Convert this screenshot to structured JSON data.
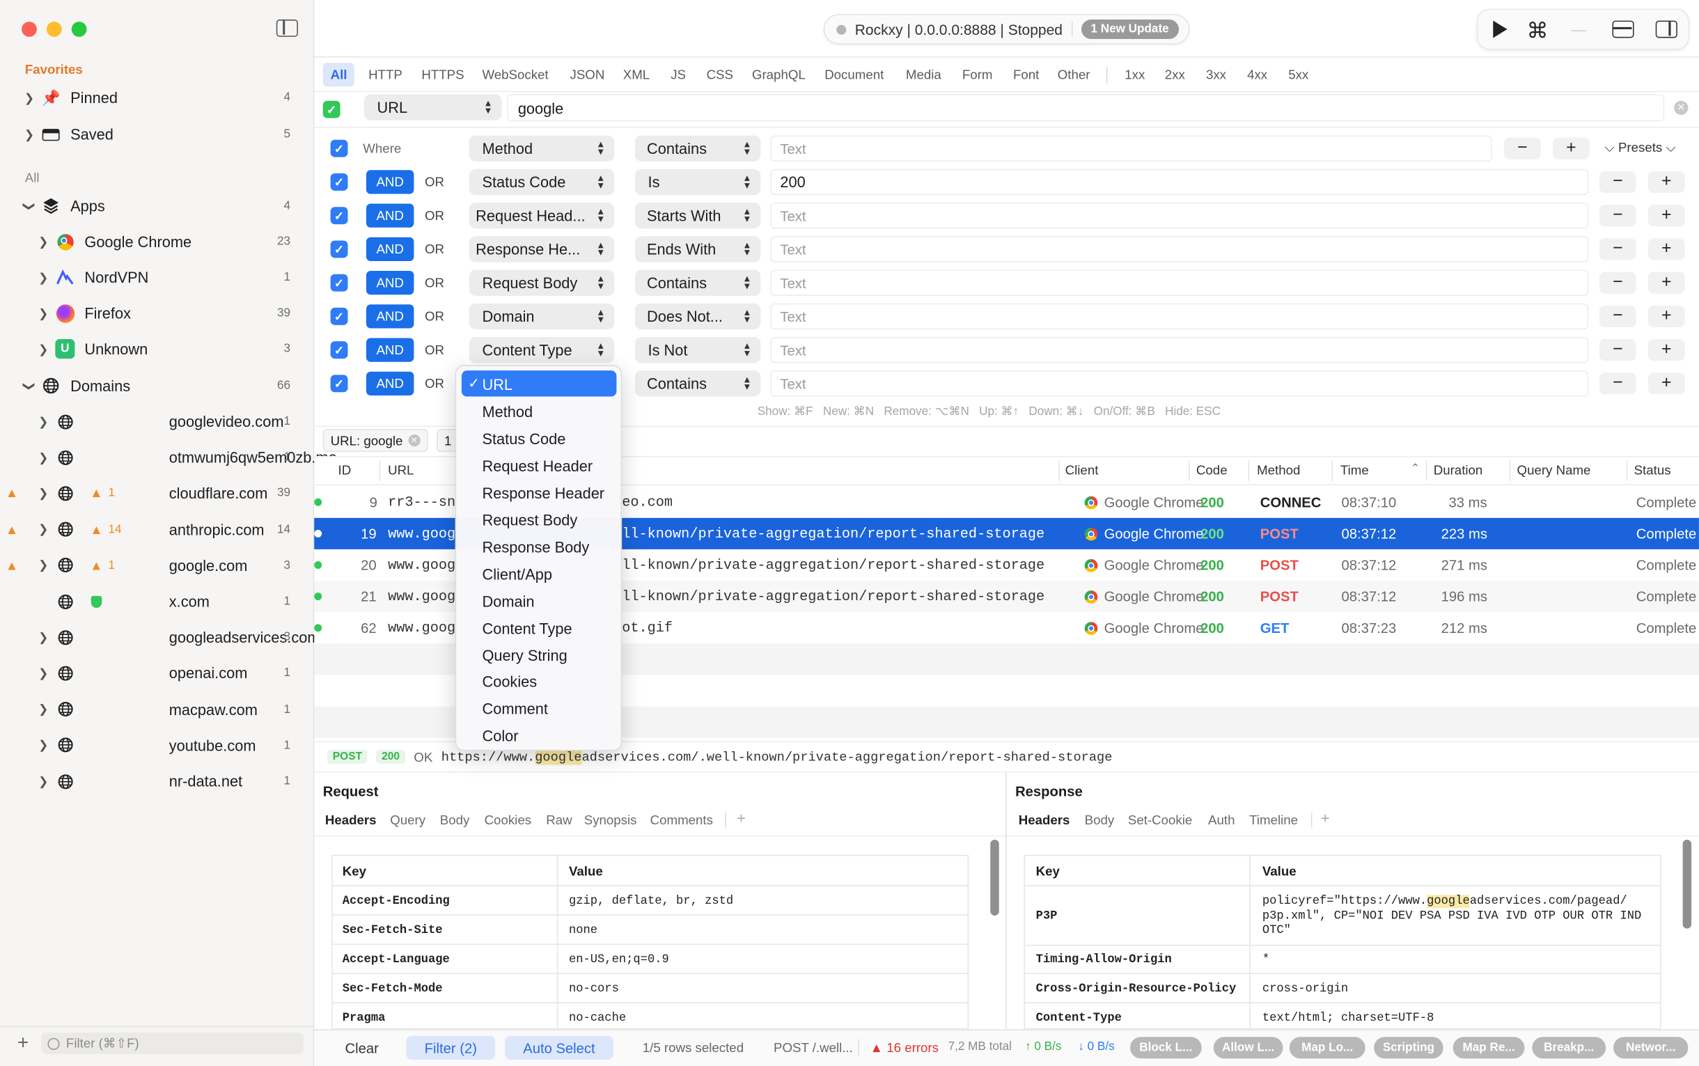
{
  "window": {
    "title": "Rockxy | 0.0.0.0:8888 | Stopped",
    "update_badge": "1 New Update"
  },
  "sidebar": {
    "favorites_label": "Favorites",
    "favorites": [
      {
        "label": "Pinned",
        "count": "4"
      },
      {
        "label": "Saved",
        "count": "5"
      }
    ],
    "all_label": "All",
    "apps": {
      "label": "Apps",
      "count": "4",
      "items": [
        {
          "label": "Google Chrome",
          "count": "23",
          "icon": "chrome-icon"
        },
        {
          "label": "NordVPN",
          "count": "1",
          "icon": "nordvpn-icon"
        },
        {
          "label": "Firefox",
          "count": "39",
          "icon": "firefox-icon"
        },
        {
          "label": "Unknown",
          "count": "3",
          "icon": "unknown-app-icon",
          "icon_letter": "U"
        }
      ]
    },
    "domains": {
      "label": "Domains",
      "count": "66",
      "items": [
        {
          "label": "googlevideo.com",
          "count": "1"
        },
        {
          "label": "otmwumj6qw5em0zb.me",
          "count": "1"
        },
        {
          "label": "cloudflare.com",
          "count": "39",
          "warn": "1"
        },
        {
          "label": "anthropic.com",
          "count": "14",
          "warn": "14"
        },
        {
          "label": "google.com",
          "count": "3",
          "warn": "1"
        },
        {
          "label": "x.com",
          "count": "1",
          "shield": true
        },
        {
          "label": "googleadservices.com",
          "count": "3"
        },
        {
          "label": "openai.com",
          "count": "1"
        },
        {
          "label": "macpaw.com",
          "count": "1"
        },
        {
          "label": "youtube.com",
          "count": "1"
        },
        {
          "label": "nr-data.net",
          "count": "1"
        }
      ]
    },
    "filter_placeholder": "Filter (⌘⇧F)"
  },
  "filter_tabs": [
    "All",
    "HTTP",
    "HTTPS",
    "WebSocket",
    "JSON",
    "XML",
    "JS",
    "CSS",
    "GraphQL",
    "Document",
    "Media",
    "Form",
    "Font",
    "Other",
    "1xx",
    "2xx",
    "3xx",
    "4xx",
    "5xx"
  ],
  "search": {
    "field": "URL",
    "value": "google"
  },
  "rules": {
    "where_label": "Where",
    "and_label": "AND",
    "or_label": "OR",
    "presets_label": "Presets",
    "rows": [
      {
        "field": "Method",
        "op": "Contains",
        "value": "",
        "placeholder": "Text"
      },
      {
        "field": "Status Code",
        "op": "Is",
        "value": "200",
        "placeholder": "Text"
      },
      {
        "field": "Request Head...",
        "op": "Starts With",
        "value": "",
        "placeholder": "Text"
      },
      {
        "field": "Response He...",
        "op": "Ends With",
        "value": "",
        "placeholder": "Text"
      },
      {
        "field": "Request Body",
        "op": "Contains",
        "value": "",
        "placeholder": "Text"
      },
      {
        "field": "Domain",
        "op": "Does Not...",
        "value": "",
        "placeholder": "Text"
      },
      {
        "field": "Content Type",
        "op": "Is Not",
        "value": "",
        "placeholder": "Text"
      },
      {
        "field": "URL",
        "op": "Contains",
        "value": "",
        "placeholder": "Text"
      }
    ],
    "shortcuts": "Show: ⌘F   New: ⌘N   Remove: ⌥⌘N   Up: ⌘↑   Down: ⌘↓   On/Off: ⌘B   Hide: ESC"
  },
  "dropdown": {
    "selected": "URL",
    "items": [
      "URL",
      "Method",
      "Status Code",
      "Request Header",
      "Response Header",
      "Request Body",
      "Response Body",
      "Client/App",
      "Domain",
      "Content Type",
      "Query String",
      "Cookies",
      "Comment",
      "Color"
    ]
  },
  "active_filter": {
    "chip": "URL: google",
    "extra": "1"
  },
  "table": {
    "columns": [
      "ID",
      "URL",
      "Client",
      "Code",
      "Method",
      "Time",
      "Duration",
      "Query Name",
      "Status"
    ],
    "rows": [
      {
        "id": "9",
        "url_a": "rr3---sn",
        "url_b": "eo.com",
        "client": "Google Chrome",
        "code": "200",
        "method": "CONNEC",
        "time": "08:37:10",
        "duration": "33 ms",
        "status": "Complete"
      },
      {
        "id": "19",
        "url_a": "www.goog",
        "url_b": "ll-known/private-aggregation/report-shared-storage",
        "client": "Google Chrome",
        "code": "200",
        "method": "POST",
        "time": "08:37:12",
        "duration": "223 ms",
        "status": "Complete",
        "selected": true
      },
      {
        "id": "20",
        "url_a": "www.goog",
        "url_b": "ll-known/private-aggregation/report-shared-storage",
        "client": "Google Chrome",
        "code": "200",
        "method": "POST",
        "time": "08:37:12",
        "duration": "271 ms",
        "status": "Complete"
      },
      {
        "id": "21",
        "url_a": "www.goog",
        "url_b": "ll-known/private-aggregation/report-shared-storage",
        "client": "Google Chrome",
        "code": "200",
        "method": "POST",
        "time": "08:37:12",
        "duration": "196 ms",
        "status": "Complete"
      },
      {
        "id": "62",
        "url_a": "www.goog",
        "url_b": "ot.gif",
        "client": "Google Chrome",
        "code": "200",
        "method": "GET",
        "time": "08:37:23",
        "duration": "212 ms",
        "status": "Complete"
      }
    ]
  },
  "detail": {
    "method": "POST",
    "code": "200",
    "status_text": "OK",
    "url_pre": "https://www.",
    "url_hl": "google",
    "url_post": "adservices.com/.well-known/private-aggregation/report-shared-storage",
    "request": {
      "title": "Request",
      "tabs": [
        "Headers",
        "Query",
        "Body",
        "Cookies",
        "Raw",
        "Synopsis",
        "Comments",
        "+"
      ],
      "key_h": "Key",
      "value_h": "Value",
      "rows": [
        {
          "k": "Accept-Encoding",
          "v": "gzip, deflate, br, zstd"
        },
        {
          "k": "Sec-Fetch-Site",
          "v": "none"
        },
        {
          "k": "Accept-Language",
          "v": "en-US,en;q=0.9"
        },
        {
          "k": "Sec-Fetch-Mode",
          "v": "no-cors"
        },
        {
          "k": "Pragma",
          "v": "no-cache"
        }
      ]
    },
    "response": {
      "title": "Response",
      "tabs": [
        "Headers",
        "Body",
        "Set-Cookie",
        "Auth",
        "Timeline",
        "+"
      ],
      "key_h": "Key",
      "value_h": "Value",
      "p3p_k": "P3P",
      "p3p_v1a": "policyref=\"https://www.",
      "p3p_v1b": "google",
      "p3p_v1c": "adservices.com/pagead/",
      "p3p_v2": "p3p.xml\", CP=\"NOI DEV PSA PSD IVA IVD OTP OUR OTR IND",
      "p3p_v3": "OTC\"",
      "rows": [
        {
          "k": "Timing-Allow-Origin",
          "v": "*"
        },
        {
          "k": "Cross-Origin-Resource-Policy",
          "v": "cross-origin"
        },
        {
          "k": "Content-Type",
          "v": "text/html; charset=UTF-8"
        }
      ]
    }
  },
  "status_bar": {
    "clear": "Clear",
    "filter": "Filter (2)",
    "auto_select": "Auto Select",
    "rows_selected": "1/5 rows selected",
    "current": "POST /.well...",
    "errors": "16 errors",
    "total": "7,2 MB total",
    "up": "↑ 0 B/s",
    "down": "↓ 0 B/s",
    "pills": [
      "Block L...",
      "Allow L...",
      "Map Lo...",
      "Scripting",
      "Map Re...",
      "Breakp...",
      "Networ..."
    ]
  },
  "colors": {
    "accent": "#1a6fe8",
    "favorites": "#e37a2c",
    "code_ok": "#34c759",
    "post": "#e8504a",
    "get": "#2f7cf6",
    "errors": "#e0352b"
  }
}
